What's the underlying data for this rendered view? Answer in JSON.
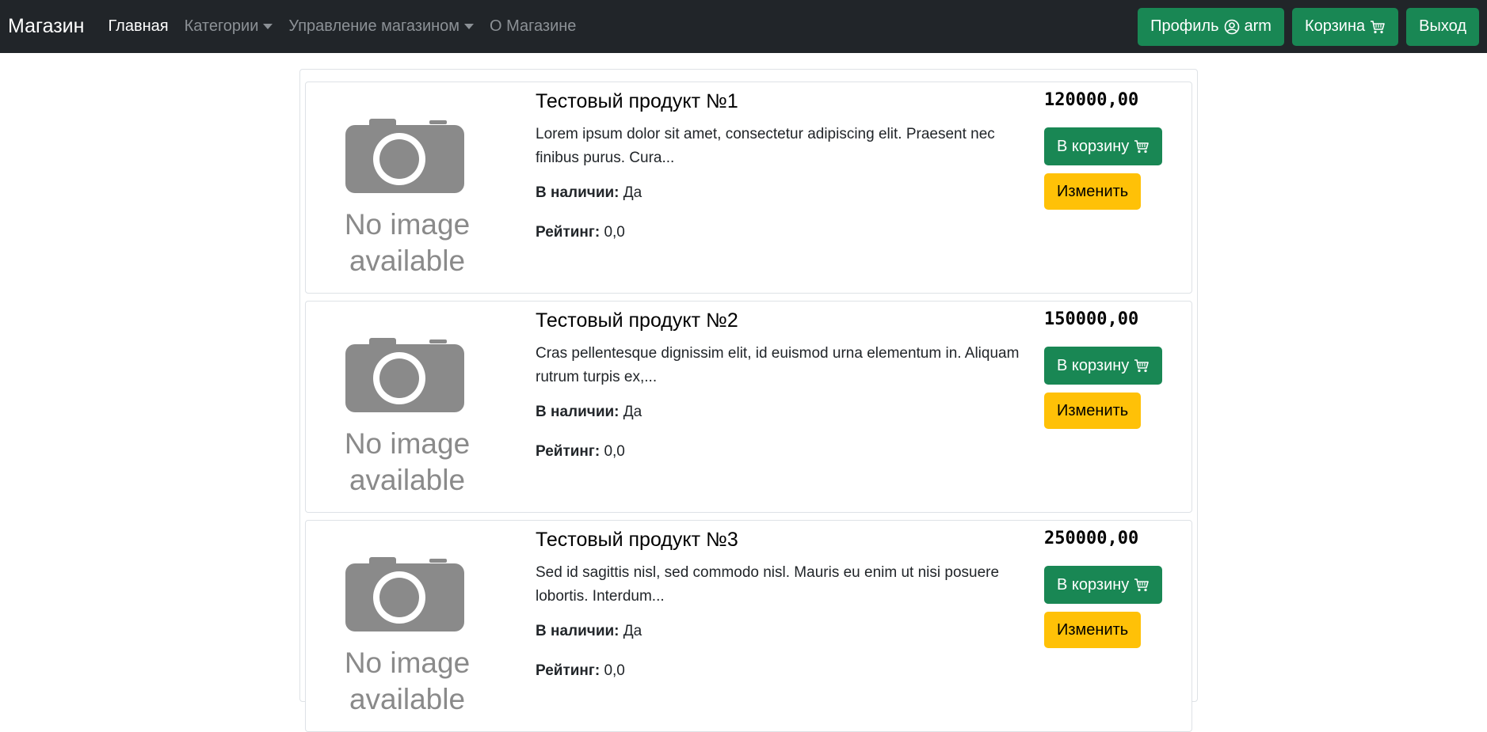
{
  "navbar": {
    "brand": "Магазин",
    "links": [
      {
        "label": "Главная",
        "active": true
      },
      {
        "label": "Категории",
        "dropdown": true
      },
      {
        "label": "Управление магазином",
        "dropdown": true
      },
      {
        "label": "О Магазине"
      }
    ],
    "profile_label": "Профиль",
    "username": "arm",
    "cart_label": "Корзина",
    "logout_label": "Выход"
  },
  "products": [
    {
      "title": "Тестовый продукт №1",
      "description": "Lorem ipsum dolor sit amet, consectetur adipiscing elit. Praesent nec finibus purus. Cura...",
      "availability_label": "В наличии:",
      "availability_value": "Да",
      "rating_label": "Рейтинг:",
      "rating_value": "0,0",
      "price": "120000,00",
      "cart_button": "В корзину",
      "edit_button": "Изменить",
      "image_text_1": "No image",
      "image_text_2": "available"
    },
    {
      "title": "Тестовый продукт №2",
      "description": "Cras pellentesque dignissim elit, id euismod urna elementum in. Aliquam rutrum turpis ex,...",
      "availability_label": "В наличии:",
      "availability_value": "Да",
      "rating_label": "Рейтинг:",
      "rating_value": "0,0",
      "price": "150000,00",
      "cart_button": "В корзину",
      "edit_button": "Изменить",
      "image_text_1": "No image",
      "image_text_2": "available"
    },
    {
      "title": "Тестовый продукт №3",
      "description": "Sed id sagittis nisl, sed commodo nisl. Mauris eu enim ut nisi posuere lobortis. Interdum...",
      "availability_label": "В наличии:",
      "availability_value": "Да",
      "rating_label": "Рейтинг:",
      "rating_value": "0,0",
      "price": "250000,00",
      "cart_button": "В корзину",
      "edit_button": "Изменить",
      "image_text_1": "No image",
      "image_text_2": "available"
    }
  ],
  "colors": {
    "navbar_bg": "#212529",
    "success": "#198754",
    "warning": "#ffc107",
    "placeholder_gray": "#8a8a8a"
  },
  "icons": {
    "profile": "person-circle-icon",
    "cart": "cart-icon",
    "placeholder": "camera-icon"
  }
}
